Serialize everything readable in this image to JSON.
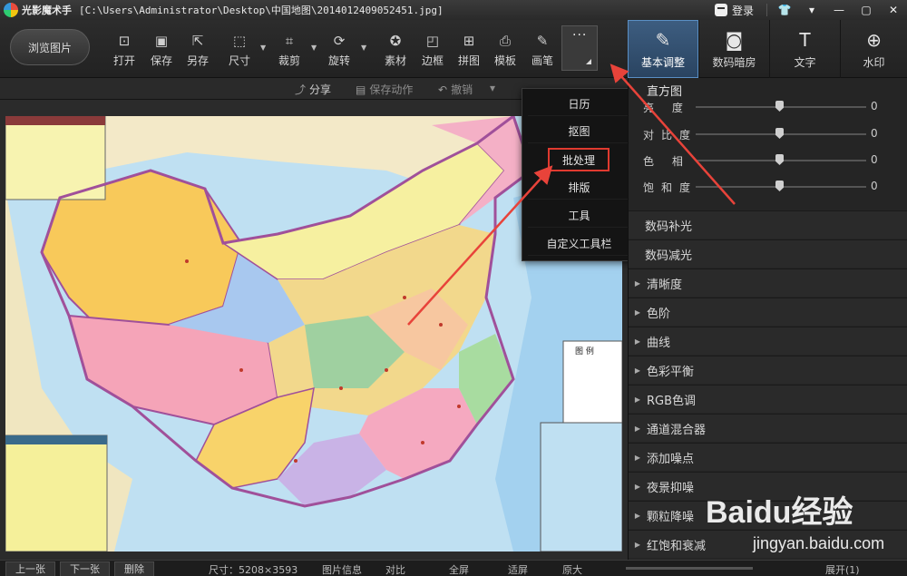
{
  "titlebar": {
    "app_name": "光影魔术手",
    "path": "[C:\\Users\\Administrator\\Desktop\\中国地图\\20140124​09052451.jpg]",
    "login_label": "登录",
    "buttons": [
      "shirt-icon",
      "menu-icon",
      "minimize-icon",
      "maximize-icon",
      "close-icon"
    ]
  },
  "toolbar": {
    "browse_label": "浏览图片",
    "tools": [
      {
        "label": "打开",
        "icon": "open-icon"
      },
      {
        "label": "保存",
        "icon": "save-icon"
      },
      {
        "label": "另存",
        "icon": "save-as-icon"
      },
      {
        "label": "尺寸",
        "icon": "resize-icon"
      },
      {
        "label": "裁剪",
        "icon": "crop-icon"
      },
      {
        "label": "旋转",
        "icon": "rotate-icon"
      },
      {
        "label": "素材",
        "icon": "material-icon"
      },
      {
        "label": "边框",
        "icon": "border-icon"
      },
      {
        "label": "拼图",
        "icon": "collage-icon"
      },
      {
        "label": "模板",
        "icon": "template-icon"
      },
      {
        "label": "画笔",
        "icon": "brush-icon"
      }
    ],
    "more_label": "···",
    "right_tabs": [
      {
        "label": "基本调整",
        "icon": "adjust-icon"
      },
      {
        "label": "数码暗房",
        "icon": "darkroom-icon"
      },
      {
        "label": "文字",
        "icon": "text-icon"
      },
      {
        "label": "水印",
        "icon": "watermark-icon"
      }
    ]
  },
  "subbar": {
    "share_label": "分享",
    "save_action_label": "保存动作",
    "undo_label": "撤销"
  },
  "dropdown": {
    "items": [
      "日历",
      "抠图",
      "批处理",
      "排版",
      "工具",
      "自定义工具栏"
    ],
    "highlighted": "批处理"
  },
  "panel": {
    "histogram_label": "直方图",
    "sliders": [
      {
        "label": "亮  度",
        "value": "0"
      },
      {
        "label": "对比度",
        "value": "0"
      },
      {
        "label": "色  相",
        "value": "0"
      },
      {
        "label": "饱和度",
        "value": "0"
      }
    ],
    "plain_sections": [
      "数码补光",
      "数码减光"
    ],
    "sections": [
      "清晰度",
      "色阶",
      "曲线",
      "色彩平衡",
      "RGB色调",
      "通道混合器",
      "添加噪点",
      "夜景抑噪",
      "颗粒降噪",
      "红饱和衰减"
    ]
  },
  "bottombar": {
    "prev_label": "上一张",
    "next_label": "下一张",
    "delete_label": "删除",
    "size_label": "尺寸：5208×3593",
    "info_label": "图片信息",
    "compare_label": "对比",
    "fullscreen_label": "全屏",
    "fit_label": "适屏",
    "original_label": "原大",
    "expand_label": "展开(1)"
  },
  "map": {
    "legend_title": "图 例"
  },
  "watermark": {
    "brand": "Baidu经验",
    "url": "jingyan.baidu.com"
  },
  "colors": {
    "accent": "#3d5d80",
    "highlight": "#e03a2f",
    "arrow": "#e8433a"
  }
}
